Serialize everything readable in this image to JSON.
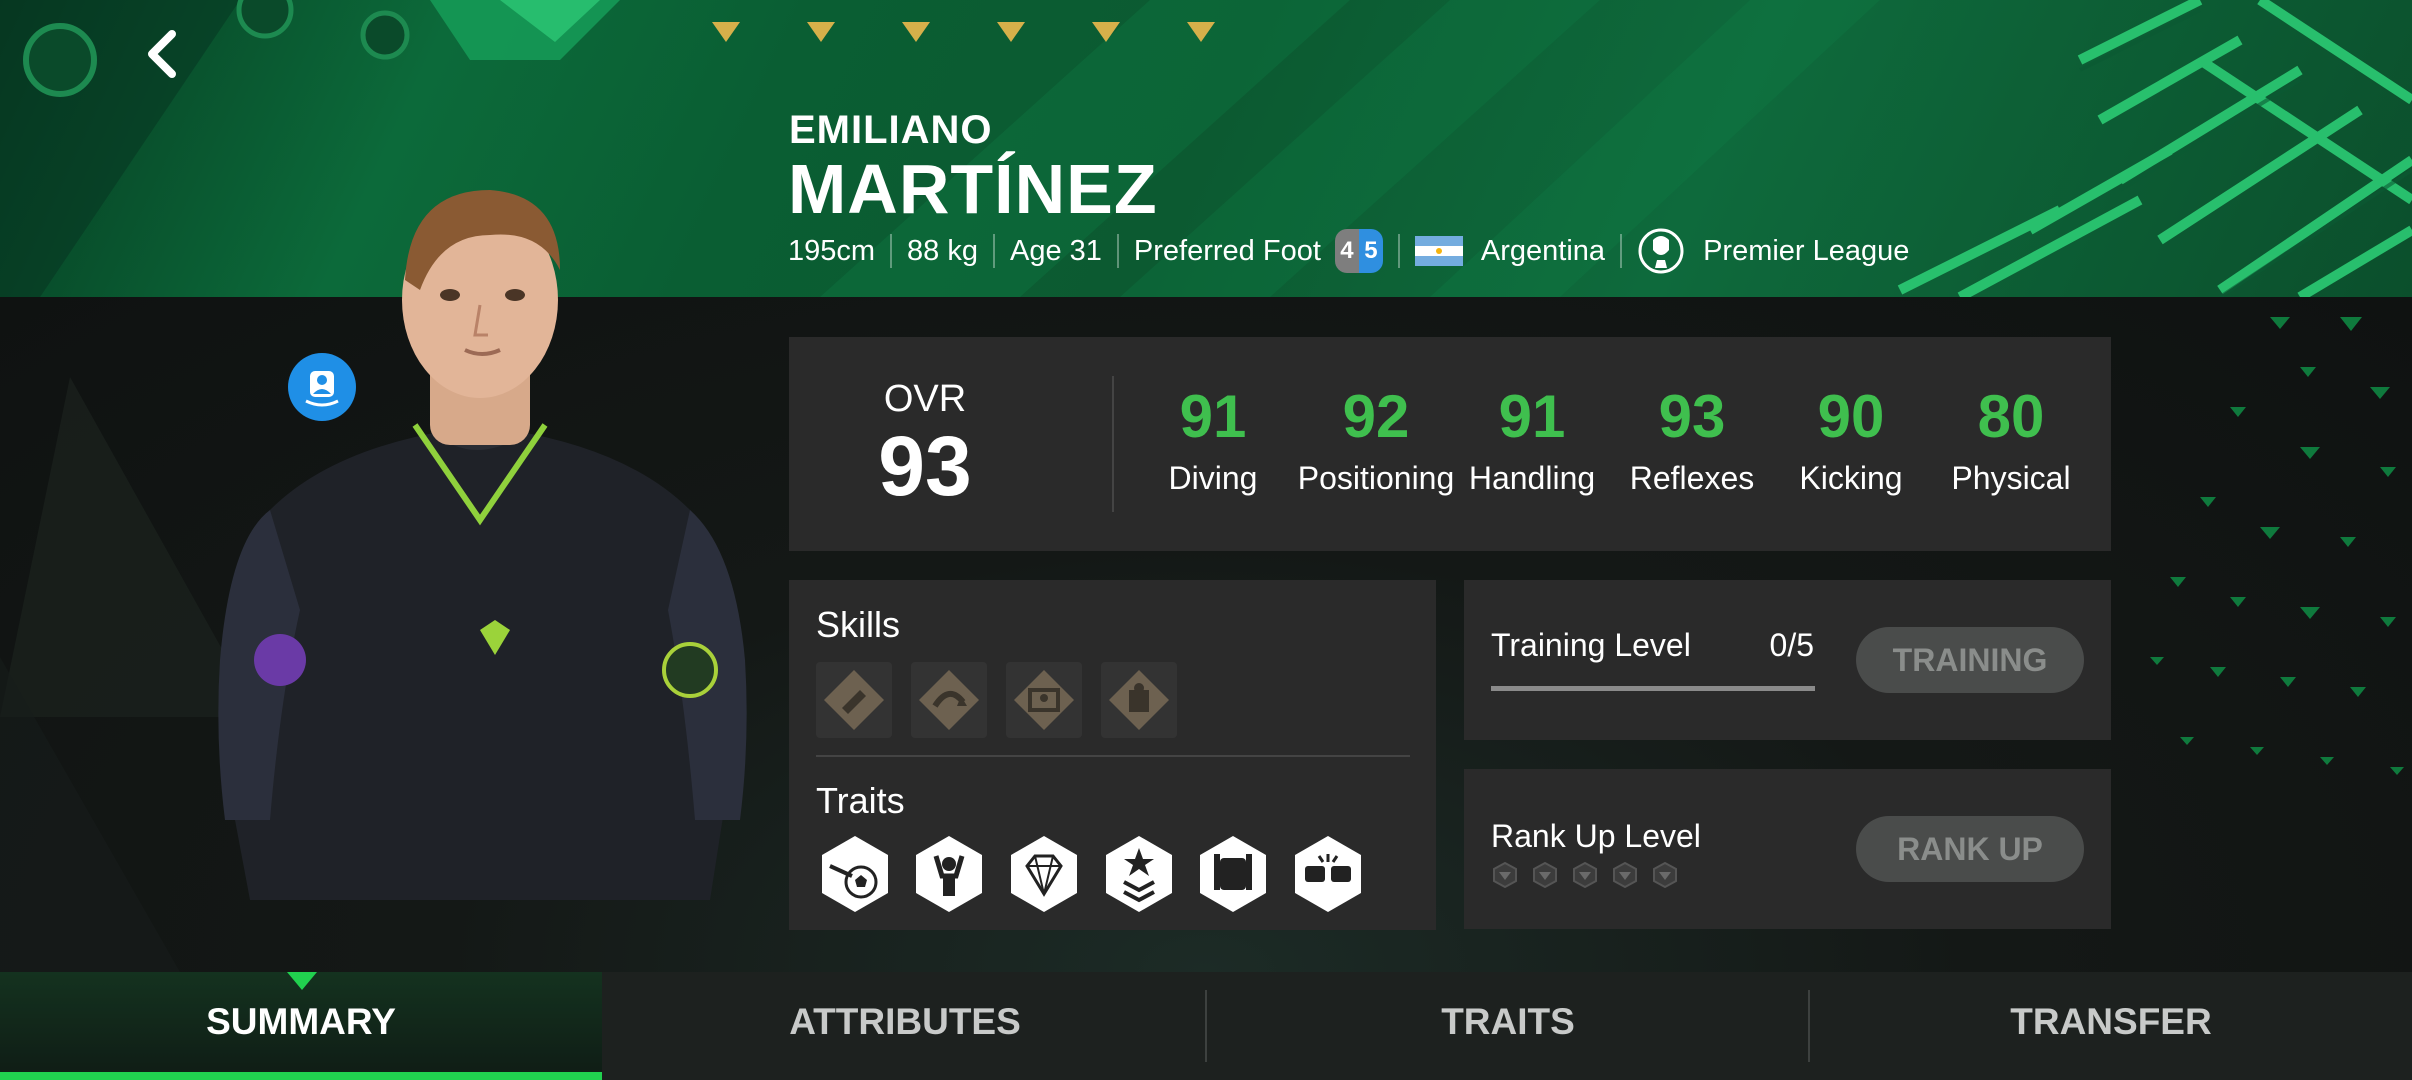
{
  "player": {
    "first_name": "EMILIANO",
    "last_name": "MARTÍNEZ"
  },
  "info": {
    "height": "195cm",
    "weight": "88 kg",
    "age": "Age 31",
    "foot_label": "Preferred Foot",
    "foot_left": "4",
    "foot_right": "5",
    "nation": "Argentina",
    "league": "Premier League"
  },
  "ovr": {
    "label": "OVR",
    "value": "93"
  },
  "stats": [
    {
      "value": "91",
      "label": "Diving"
    },
    {
      "value": "92",
      "label": "Positioning"
    },
    {
      "value": "91",
      "label": "Handling"
    },
    {
      "value": "93",
      "label": "Reflexes"
    },
    {
      "value": "90",
      "label": "Kicking"
    },
    {
      "value": "80",
      "label": "Physical"
    }
  ],
  "skills": {
    "title": "Skills",
    "icons": [
      "dive-glove-icon",
      "save-arc-icon",
      "goalkeeper-goal-icon",
      "wall-block-icon"
    ]
  },
  "traits": {
    "title": "Traits",
    "icons": [
      "ball-strike-icon",
      "celebration-icon",
      "diamond-icon",
      "rank-star-icon",
      "glove-catch-icon",
      "fist-bump-icon"
    ]
  },
  "training": {
    "label": "Training Level",
    "value": "0/5",
    "progress": 0,
    "button": "TRAINING"
  },
  "rank": {
    "label": "Rank Up Level",
    "level": 0,
    "max": 5,
    "button": "RANK UP"
  },
  "tabs": [
    "SUMMARY",
    "ATTRIBUTES",
    "TRAITS",
    "TRANSFER"
  ],
  "active_tab": "SUMMARY",
  "colors": {
    "stat_green": "#3fbf4e",
    "accent": "#21d14f",
    "banner_green": "#0c6a3a"
  }
}
